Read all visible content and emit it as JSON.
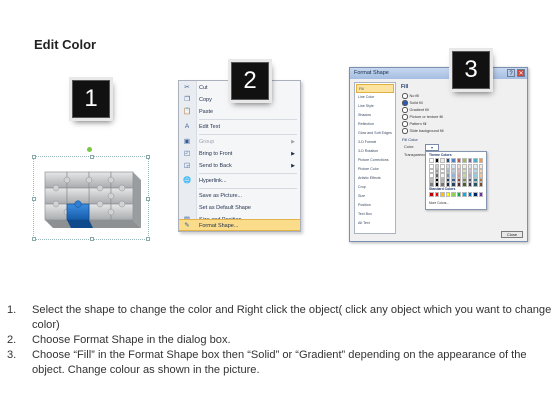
{
  "page": {
    "title": "Edit Color"
  },
  "steps": [
    "1",
    "2",
    "3"
  ],
  "context_menu": {
    "items": [
      {
        "label": "Cut",
        "icon": "scissors-icon",
        "glyph": "✂",
        "disabled": false
      },
      {
        "label": "Copy",
        "icon": "copy-icon",
        "glyph": "❐",
        "disabled": false
      },
      {
        "label": "Paste",
        "icon": "clipboard-icon",
        "glyph": "📋",
        "disabled": false
      },
      {
        "label": "Edit Text",
        "icon": "text-edit-icon",
        "glyph": "A",
        "disabled": false
      },
      {
        "label": "Group",
        "icon": "group-icon",
        "glyph": "▣",
        "disabled": true,
        "submenu": true
      },
      {
        "label": "Bring to Front",
        "icon": "bring-front-icon",
        "glyph": "◰",
        "disabled": false,
        "submenu": true
      },
      {
        "label": "Send to Back",
        "icon": "send-back-icon",
        "glyph": "◲",
        "disabled": false,
        "submenu": true
      },
      {
        "label": "Hyperlink...",
        "icon": "hyperlink-icon",
        "glyph": "🌐",
        "disabled": false
      },
      {
        "label": "Save as Picture...",
        "icon": "save-picture-icon",
        "glyph": "",
        "disabled": false
      },
      {
        "label": "Set as Default Shape",
        "icon": "default-shape-icon",
        "glyph": "",
        "disabled": false
      },
      {
        "label": "Size and Position...",
        "icon": "size-position-icon",
        "glyph": "▤",
        "disabled": false
      },
      {
        "label": "Format Shape...",
        "icon": "format-shape-icon",
        "glyph": "✎",
        "disabled": false,
        "highlighted": true
      }
    ]
  },
  "format_dialog": {
    "title": "Format Shape",
    "help": "?",
    "close": "✕",
    "categories": [
      "Fill",
      "Line Color",
      "Line Style",
      "Shadow",
      "Reflection",
      "Glow and Soft Edges",
      "3-D Format",
      "3-D Rotation",
      "Picture Corrections",
      "Picture Color",
      "Artistic Effects",
      "Crop",
      "Size",
      "Position",
      "Text Box",
      "Alt Text"
    ],
    "active_category": "Fill",
    "fill_heading": "Fill",
    "fill_options": [
      {
        "label": "No fill",
        "selected": false
      },
      {
        "label": "Solid fill",
        "selected": true
      },
      {
        "label": "Gradient fill",
        "selected": false
      },
      {
        "label": "Picture or texture fill",
        "selected": false
      },
      {
        "label": "Pattern fill",
        "selected": false
      },
      {
        "label": "Slide background fill",
        "selected": false
      }
    ],
    "fill_color_heading": "Fill Color",
    "color_label": "Color:",
    "transparency_label": "Transparency:",
    "palette": {
      "theme_title": "Theme Colors",
      "standard_title": "Standard Colors",
      "theme_colors": [
        "#ffffff",
        "#000000",
        "#eeece1",
        "#1f497d",
        "#4f81bd",
        "#c0504d",
        "#9bbb59",
        "#8064a2",
        "#4bacc6",
        "#f79646"
      ],
      "standard_colors": [
        "#c00000",
        "#ff0000",
        "#ffc000",
        "#ffff00",
        "#92d050",
        "#00b050",
        "#00b0f0",
        "#0070c0",
        "#002060",
        "#7030a0"
      ],
      "more_colors": "More Colors..."
    },
    "close_button": "Close"
  },
  "instructions": [
    {
      "num": "1.",
      "text": "Select the shape to change the color and Right click the object( click any object which you want to change color)"
    },
    {
      "num": "2.",
      "text": "Choose Format Shape in the dialog box."
    },
    {
      "num": "3.",
      "text": "Choose “Fill” in the Format Shape box then “Solid” or “Gradient” depending on the appearance of the object. Change colour as shown in the picture."
    }
  ],
  "colors": {
    "puzzle_gray": "#c4c6c8",
    "puzzle_blue": "#1f6fc2",
    "menu_highlight": "#fbdc8a"
  }
}
